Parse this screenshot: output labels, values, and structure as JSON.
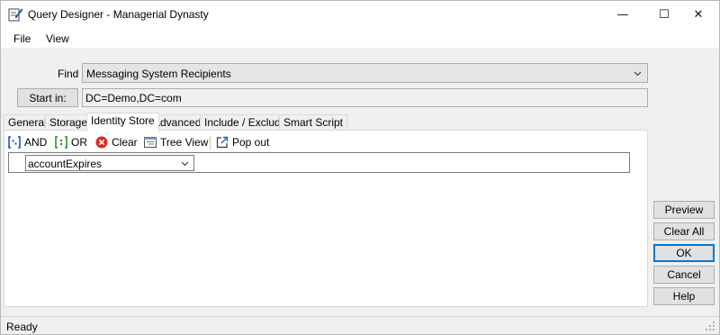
{
  "window": {
    "title": "Query Designer - Managerial Dynasty",
    "minimize_glyph": "—",
    "maximize_glyph": "☐",
    "close_glyph": "✕"
  },
  "menu": {
    "items": [
      {
        "label": "File"
      },
      {
        "label": "View"
      }
    ]
  },
  "find": {
    "label": "Find",
    "selected": "Messaging System Recipients"
  },
  "start_in": {
    "button_label": "Start in:",
    "value": "DC=Demo,DC=com"
  },
  "tabs": [
    {
      "label": "General"
    },
    {
      "label": "Storage"
    },
    {
      "label": "Identity Store",
      "active": true
    },
    {
      "label": "Advanced"
    },
    {
      "label": "Include / Exclude"
    },
    {
      "label": "Smart Script"
    }
  ],
  "toolbar": {
    "and_label": "AND",
    "or_label": "OR",
    "clear_label": "Clear",
    "tree_view_label": "Tree View",
    "pop_out_label": "Pop out"
  },
  "condition": {
    "attribute": "accountExpires"
  },
  "side_buttons": {
    "preview": "Preview",
    "clear_all": "Clear All",
    "ok": "OK",
    "cancel": "Cancel",
    "help": "Help"
  },
  "status": {
    "text": "Ready"
  },
  "colors": {
    "and_icon": "#1f4fbf",
    "or_icon": "#2e8b2e",
    "clear_icon": "#d62a2a",
    "accent": "#0078d7"
  }
}
